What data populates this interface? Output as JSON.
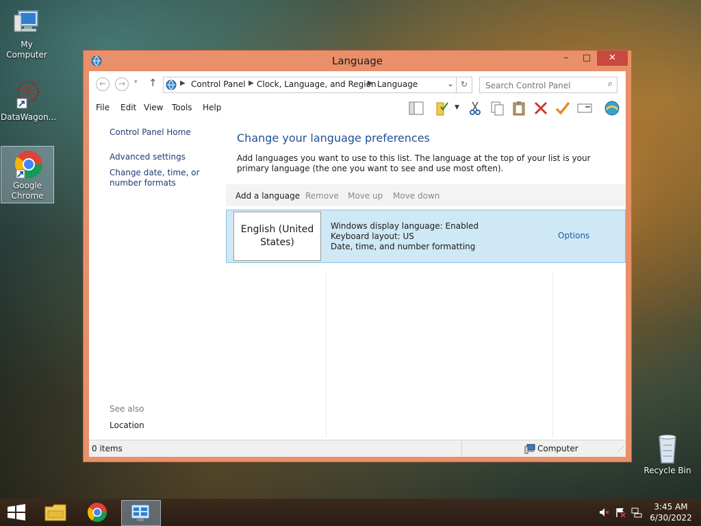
{
  "desktop": {
    "icons": [
      {
        "label": "My Computer"
      },
      {
        "label": "DataWagon..."
      },
      {
        "label": "Google Chrome"
      },
      {
        "label": "Recycle Bin"
      }
    ]
  },
  "window": {
    "title": "Language",
    "controls": {
      "minimize": "–",
      "maximize": "□",
      "close": "✕"
    }
  },
  "address": {
    "breadcrumbs": [
      "Control Panel",
      "Clock, Language, and Region",
      "Language"
    ],
    "search_placeholder": "Search Control Panel"
  },
  "menu": [
    "File",
    "Edit",
    "View",
    "Tools",
    "Help"
  ],
  "sidebar": {
    "home": "Control Panel Home",
    "links": [
      "Advanced settings",
      "Change date, time, or number formats"
    ],
    "see_also": "See also",
    "see_also_links": [
      "Location"
    ]
  },
  "main": {
    "title": "Change your language preferences",
    "description": "Add languages you want to use to this list. The language at the top of your list is your primary language (the one you want to see and use most often).",
    "commands": [
      "Add a language",
      "Remove",
      "Move up",
      "Move down"
    ],
    "languages": [
      {
        "name": "English (United States)",
        "details": [
          "Windows display language: Enabled",
          "Keyboard layout: US",
          "Date, time, and number formatting"
        ],
        "action": "Options"
      }
    ]
  },
  "status": {
    "items": "0 items",
    "location": "Computer"
  },
  "taskbar": {
    "time": "3:45 AM",
    "date": "6/30/2022"
  },
  "colors": {
    "title_blue": "#1f4e99",
    "link_blue": "#1f5aa6",
    "selection": "#cfe8f5",
    "window_frame": "#e9906a",
    "close_red": "#c7493f"
  }
}
